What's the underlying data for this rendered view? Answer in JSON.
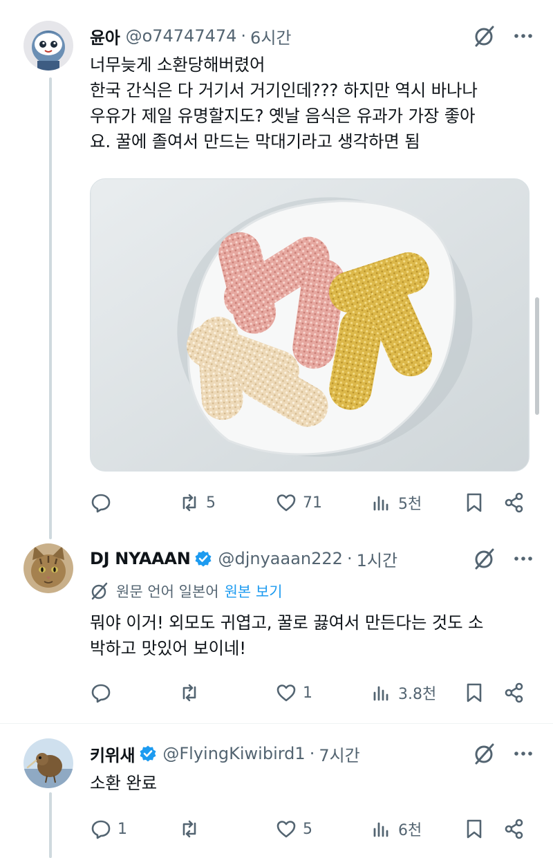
{
  "colors": {
    "accent": "#1d9bf0",
    "muted": "#536471",
    "text": "#0f1419",
    "thread_line": "#cfd9de"
  },
  "tweets": [
    {
      "name": "윤아",
      "handle": "@o74747474",
      "separator": "·",
      "time": "6시간",
      "verified": false,
      "lines": [
        "너무늦게 소환당해버렸어",
        "한국 간식은 다 거기서 거기인데??? 하지만 역시 바나나",
        "우유가 제일 유명할지도? 옛날 음식은 유과가 가장 좋아",
        "요. 꿀에 졸여서 만드는 막대기라고 생각하면 됨"
      ],
      "media": "yugwa-photo",
      "stats": {
        "replies": "",
        "reposts": "5",
        "likes": "71",
        "views": "5천"
      }
    },
    {
      "name": "DJ NYAAAN",
      "handle": "@djnyaaan222",
      "separator": "·",
      "time": "1시간",
      "verified": true,
      "translation": {
        "label": "원문 언어 일본어",
        "link": "원본 보기"
      },
      "lines": [
        "뭐야 이거! 외모도 귀엽고, 꿀로 끓여서 만든다는 것도 소",
        "박하고 맛있어 보이네!"
      ],
      "stats": {
        "replies": "",
        "reposts": "",
        "likes": "1",
        "views": "3.8천"
      }
    },
    {
      "name": "키위새",
      "handle": "@FlyingKiwibird1",
      "separator": "·",
      "time": "7시간",
      "verified": true,
      "lines": [
        "소환 완료"
      ],
      "stats": {
        "replies": "1",
        "reposts": "",
        "likes": "5",
        "views": "6천"
      }
    }
  ],
  "icons": [
    "grok-icon",
    "more-icon",
    "reply-icon",
    "repost-icon",
    "like-icon",
    "views-icon",
    "bookmark-icon",
    "share-icon",
    "verified-badge-icon",
    "translate-icon"
  ]
}
